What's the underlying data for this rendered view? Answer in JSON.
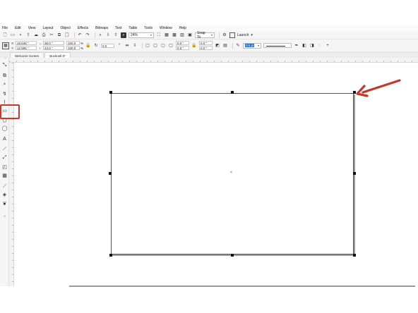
{
  "menu": [
    "File",
    "Edit",
    "View",
    "Layout",
    "Object",
    "Effects",
    "Bitmaps",
    "Text",
    "Table",
    "Tools",
    "Window",
    "Help"
  ],
  "toolbar": {
    "zoom": "24%",
    "snap_to": "Snap To",
    "launch": "Launch"
  },
  "propbar": {
    "x_label": "X:",
    "x_value": "18.646 \"",
    "y_label": "Y:",
    "y_value": "12.595 \"",
    "w_value": "36.0 \"",
    "h_value": "24.0 \"",
    "scale_w": "100.0",
    "scale_h": "100.0",
    "scale_unit": "%",
    "rotation": "0.0",
    "corner_1": "0.0 \"",
    "corner_2": "0.0 \"",
    "corner_3": "0.0 \"",
    "corner_4": "0.0 \"",
    "outline_width": "0.5 pt"
  },
  "tabs": [
    {
      "label": "Welcome Screen",
      "active": false
    },
    {
      "label": "Bucknell 8*",
      "active": true
    }
  ],
  "colors": {
    "highlight": "#c0392b",
    "arrow": "#c0392b",
    "accent": "#2b6cc4"
  },
  "icons": {
    "pick": "pick-tool-icon",
    "rectangle": "rectangle-tool-icon",
    "ellipse": "ellipse-tool-icon",
    "text": "text-tool-icon"
  }
}
